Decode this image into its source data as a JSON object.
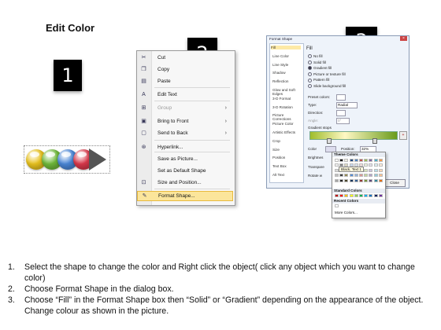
{
  "heading": "Edit Color",
  "badges": [
    "1",
    "2",
    "3"
  ],
  "shape": {
    "bead_colors": [
      "#e8c21e",
      "#6fb83a",
      "#4a86d6",
      "#d8384a"
    ],
    "arrow_color": "#555555"
  },
  "context_menu": {
    "items": [
      {
        "label": "Cut",
        "icon": "scissors-icon",
        "glyph": "✂",
        "disabled": false,
        "submenu": false
      },
      {
        "label": "Copy",
        "icon": "copy-icon",
        "glyph": "❐",
        "disabled": false,
        "submenu": false
      },
      {
        "label": "Paste",
        "icon": "paste-icon",
        "glyph": "▤",
        "disabled": false,
        "submenu": false
      },
      {
        "label": "Edit Text",
        "icon": "edit-text-icon",
        "glyph": "A",
        "disabled": false,
        "submenu": false
      },
      {
        "label": "Group",
        "icon": "group-icon",
        "glyph": "⊞",
        "disabled": true,
        "submenu": true
      },
      {
        "label": "Bring to Front",
        "icon": "bring-front-icon",
        "glyph": "▣",
        "disabled": false,
        "submenu": true
      },
      {
        "label": "Send to Back",
        "icon": "send-back-icon",
        "glyph": "▢",
        "disabled": false,
        "submenu": true
      },
      {
        "label": "Hyperlink...",
        "icon": "hyperlink-icon",
        "glyph": "⊛",
        "disabled": false,
        "submenu": false
      },
      {
        "label": "Save as Picture...",
        "icon": "",
        "glyph": "",
        "disabled": false,
        "submenu": false
      },
      {
        "label": "Set as Default Shape",
        "icon": "",
        "glyph": "",
        "disabled": false,
        "submenu": false
      },
      {
        "label": "Size and Position...",
        "icon": "size-position-icon",
        "glyph": "⊡",
        "disabled": false,
        "submenu": false
      },
      {
        "label": "Format Shape...",
        "icon": "format-shape-icon",
        "glyph": "✎",
        "disabled": false,
        "submenu": false,
        "highlighted": true
      }
    ]
  },
  "format_dialog": {
    "title": "Format Shape",
    "close_glyph": "×",
    "nav": [
      "Fill",
      "Line Color",
      "Line Style",
      "Shadow",
      "Reflection",
      "Glow and Soft Edges",
      "3-D Format",
      "3-D Rotation",
      "Picture Corrections",
      "Picture Color",
      "Artistic Effects",
      "Crop",
      "Size",
      "Position",
      "Text Box",
      "Alt Text"
    ],
    "fill_heading": "Fill",
    "fill_options": [
      "No fill",
      "Solid fill",
      "Gradient fill",
      "Picture or texture fill",
      "Pattern fill",
      "Slide background fill"
    ],
    "selected_fill": 2,
    "preset_colors_label": "Preset colors:",
    "type_label": "Type:",
    "type_value": "Radial",
    "direction_label": "Direction:",
    "angle_label": "Angle:",
    "angle_value": "0°",
    "gradient_stops_label": "Gradient stops",
    "color_label": "Color",
    "position_label": "Position:",
    "position_value": "32%",
    "brightness_label": "Brightnes",
    "transparency_label": "Transpare",
    "rotate_label": "Rotate w",
    "close_label": "Close"
  },
  "palette": {
    "theme_label": "Theme Colors",
    "tooltip": "Black, Text 1",
    "theme_rows": [
      [
        "#ffffff",
        "#000000",
        "#eeece1",
        "#1f497d",
        "#4f81bd",
        "#c0504d",
        "#9bbb59",
        "#8064a2",
        "#4bacc6",
        "#f79646"
      ],
      [
        "#f2f2f2",
        "#7f7f7f",
        "#ddd9c3",
        "#c6d9f0",
        "#dbe5f1",
        "#f2dcdb",
        "#ebf1dd",
        "#e5e0ec",
        "#dbeef3",
        "#fdeada"
      ],
      [
        "#d8d8d8",
        "#595959",
        "#c4bd97",
        "#8db3e2",
        "#b8cce4",
        "#e5b9b7",
        "#d7e3bc",
        "#ccc1d9",
        "#b7dde8",
        "#fbd5b5"
      ],
      [
        "#bfbfbf",
        "#3f3f3f",
        "#938953",
        "#548dd4",
        "#95b3d7",
        "#d99694",
        "#c3d69b",
        "#b2a2c7",
        "#92cddc",
        "#fac08f"
      ],
      [
        "#a5a5a5",
        "#262626",
        "#494429",
        "#17365d",
        "#366092",
        "#953734",
        "#76923c",
        "#5f497a",
        "#31859b",
        "#e36c09"
      ]
    ],
    "standard_label": "Standard Colors",
    "standard": [
      "#c00000",
      "#ff0000",
      "#ffc000",
      "#ffff00",
      "#92d050",
      "#00b050",
      "#00b0f0",
      "#0070c0",
      "#002060",
      "#7030a0"
    ],
    "recent_label": "Recent Colors",
    "recent": [
      "#ffffff"
    ],
    "more_label": "More Colors..."
  },
  "steps": [
    {
      "num": "1.",
      "text": "Select the shape to change the color and Right click the object( click any object which you want to change color)"
    },
    {
      "num": "2.",
      "text": "Choose Format Shape in the dialog box."
    },
    {
      "num": "3.",
      "text": "Choose “Fill” in the Format Shape box then “Solid” or “Gradient” depending on the appearance of the object. Change colour as shown in the picture."
    }
  ]
}
